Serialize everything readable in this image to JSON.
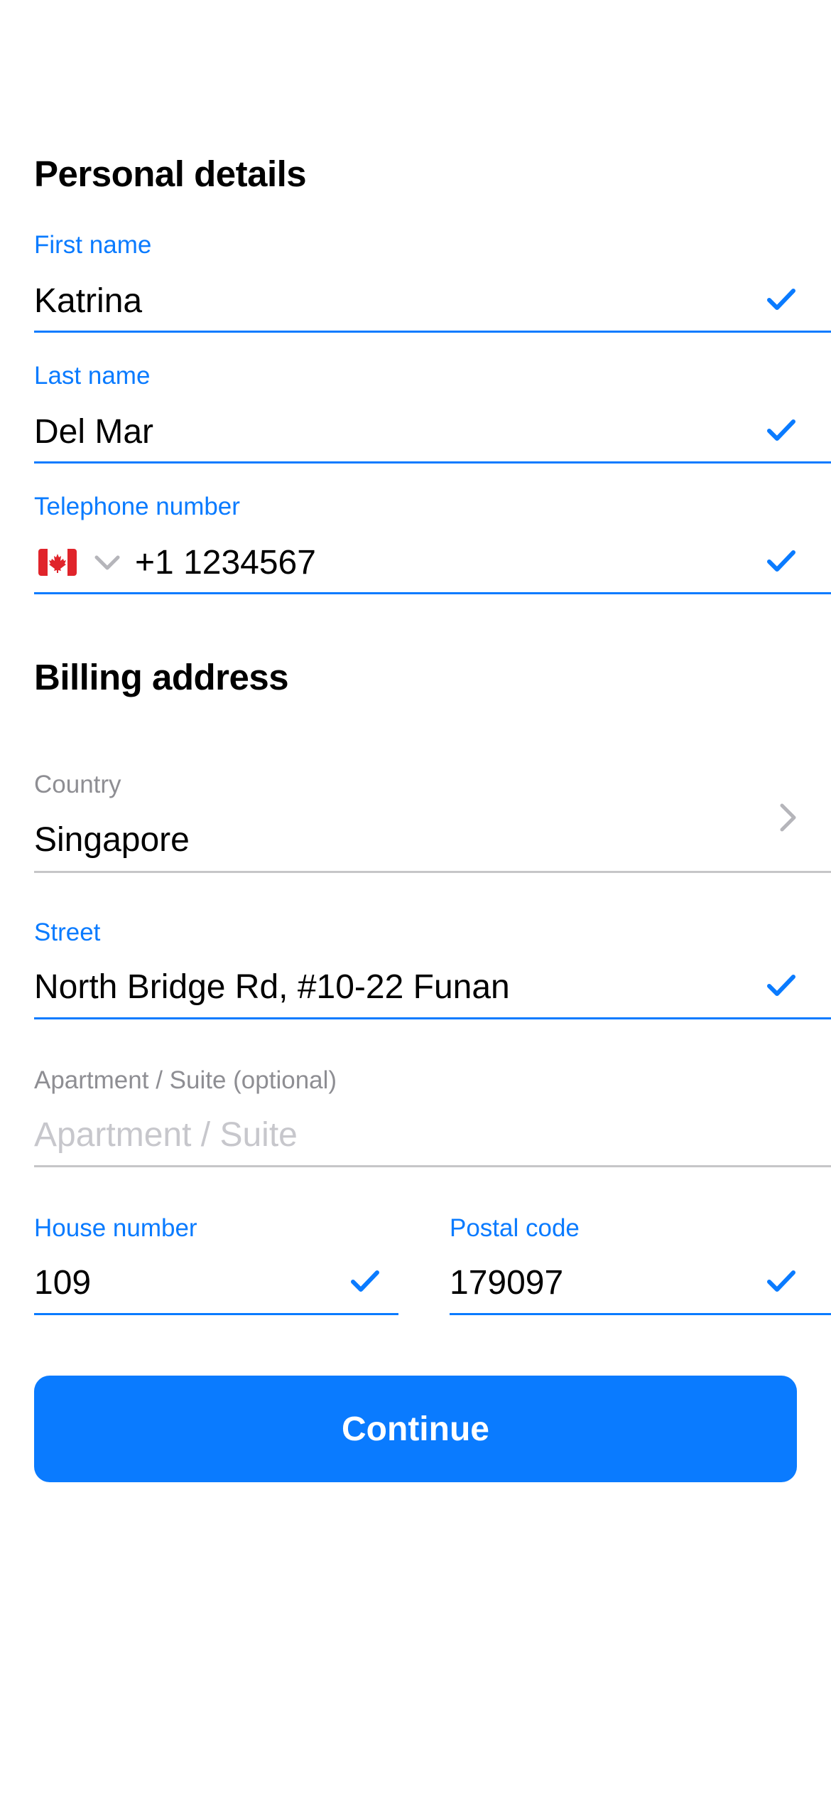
{
  "personal_details": {
    "title": "Personal details",
    "first_name": {
      "label": "First name",
      "value": "Katrina",
      "valid": true
    },
    "last_name": {
      "label": "Last name",
      "value": "Del Mar",
      "valid": true
    },
    "telephone": {
      "label": "Telephone number",
      "country_flag": "canada-flag-icon",
      "value": "+1 1234567",
      "valid": true
    }
  },
  "billing_address": {
    "title": "Billing address",
    "country": {
      "label": "Country",
      "value": "Singapore"
    },
    "street": {
      "label": "Street",
      "value": "North Bridge Rd, #10-22 Funan",
      "valid": true
    },
    "apartment": {
      "label": "Apartment / Suite (optional)",
      "placeholder": "Apartment / Suite",
      "value": ""
    },
    "house_number": {
      "label": "House number",
      "value": "109",
      "valid": true
    },
    "postal_code": {
      "label": "Postal code",
      "value": "179097",
      "valid": true
    }
  },
  "continue_button": {
    "label": "Continue"
  },
  "colors": {
    "accent": "#0a7bff",
    "label_grey": "#8e8e93",
    "placeholder_grey": "#c7c7cc",
    "divider_grey": "#c6c6c8"
  }
}
